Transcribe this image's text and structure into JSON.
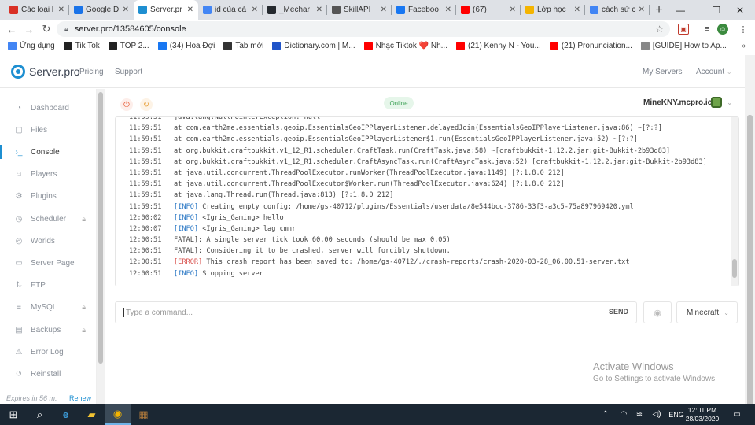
{
  "browser": {
    "tabs": [
      {
        "label": "Các loại l",
        "color": "#d93025"
      },
      {
        "label": "Google D",
        "color": "#1a73e8"
      },
      {
        "label": "Server.pr",
        "color": "#1e8fd1"
      },
      {
        "label": "id của cá",
        "color": "#4285f4"
      },
      {
        "label": "_Mechar",
        "color": "#24292e"
      },
      {
        "label": "SkillAPI",
        "color": "#555555"
      },
      {
        "label": "Faceboo",
        "color": "#1877f2"
      },
      {
        "label": "(67)",
        "color": "#ff0000"
      },
      {
        "label": "Lớp học",
        "color": "#f4b400"
      },
      {
        "label": "cách sử c",
        "color": "#4285f4"
      }
    ],
    "url": "server.pro/13584605/console",
    "bookmarks": [
      {
        "label": "Ứng dụng",
        "icon": "apps-grid-icon",
        "color": "#4285f4"
      },
      {
        "label": "Tik Tok",
        "icon": "music-note-icon",
        "color": "#222222"
      },
      {
        "label": "TOP 2...",
        "icon": "tiktok-icon",
        "color": "#222222"
      },
      {
        "label": "(34) Hoa Đợi",
        "icon": "facebook-icon",
        "color": "#1877f2"
      },
      {
        "label": "Tab mới",
        "icon": "globe-icon",
        "color": "#333333"
      },
      {
        "label": "Dictionary.com | M...",
        "icon": "dictionary-icon",
        "color": "#2054c8"
      },
      {
        "label": "Nhạc Tiktok ❤️ Nh...",
        "icon": "youtube-icon",
        "color": "#ff0000"
      },
      {
        "label": "(21) Kenny N - You...",
        "icon": "youtube-icon",
        "color": "#ff0000"
      },
      {
        "label": "(21) Pronunciation...",
        "icon": "youtube-icon",
        "color": "#ff0000"
      },
      {
        "label": "[GUIDE] How to Ap...",
        "icon": "page-icon",
        "color": "#888888"
      }
    ]
  },
  "site": {
    "logo": "Server.pro",
    "nav": {
      "pricing": "Pricing",
      "support": "Support",
      "my_servers": "My Servers",
      "account": "Account"
    },
    "sidebar": [
      {
        "label": "Dashboard",
        "icon": "◔",
        "locked": false,
        "active": false
      },
      {
        "label": "Files",
        "icon": "▢",
        "locked": false,
        "active": false
      },
      {
        "label": "Console",
        "icon": "›_",
        "locked": false,
        "active": true
      },
      {
        "label": "Players",
        "icon": "☺",
        "locked": false,
        "active": false
      },
      {
        "label": "Plugins",
        "icon": "⚙",
        "locked": false,
        "active": false
      },
      {
        "label": "Scheduler",
        "icon": "◷",
        "locked": true,
        "active": false
      },
      {
        "label": "Worlds",
        "icon": "◎",
        "locked": false,
        "active": false
      },
      {
        "label": "Server Page",
        "icon": "▭",
        "locked": false,
        "active": false
      },
      {
        "label": "FTP",
        "icon": "⇅",
        "locked": false,
        "active": false
      },
      {
        "label": "MySQL",
        "icon": "≡",
        "locked": true,
        "active": false
      },
      {
        "label": "Backups",
        "icon": "▤",
        "locked": true,
        "active": false
      },
      {
        "label": "Error Log",
        "icon": "⚠",
        "locked": false,
        "active": false
      },
      {
        "label": "Reinstall",
        "icon": "↺",
        "locked": false,
        "active": false
      }
    ],
    "expires": "Expires in 56 m.",
    "renew": "Renew",
    "status": "Online",
    "server_name": "MineKNY.mcpro.io",
    "console_lines": [
      {
        "time": "11:59:51",
        "tag": "",
        "text": "java.lang.NullPointerException: null"
      },
      {
        "time": "11:59:51",
        "tag": "",
        "text": "at com.earth2me.essentials.geoip.EssentialsGeoIPPlayerListener.delayedJoin(EssentialsGeoIPPlayerListener.java:86) ~[?:?]"
      },
      {
        "time": "11:59:51",
        "tag": "",
        "text": "at com.earth2me.essentials.geoip.EssentialsGeoIPPlayerListener$1.run(EssentialsGeoIPPlayerListener.java:52) ~[?:?]"
      },
      {
        "time": "11:59:51",
        "tag": "",
        "text": "at org.bukkit.craftbukkit.v1_12_R1.scheduler.CraftTask.run(CraftTask.java:58) ~[craftbukkit-1.12.2.jar:git-Bukkit-2b93d83]"
      },
      {
        "time": "11:59:51",
        "tag": "",
        "text": "at org.bukkit.craftbukkit.v1_12_R1.scheduler.CraftAsyncTask.run(CraftAsyncTask.java:52) [craftbukkit-1.12.2.jar:git-Bukkit-2b93d83]"
      },
      {
        "time": "11:59:51",
        "tag": "",
        "text": "at java.util.concurrent.ThreadPoolExecutor.runWorker(ThreadPoolExecutor.java:1149) [?:1.8.0_212]"
      },
      {
        "time": "11:59:51",
        "tag": "",
        "text": "at java.util.concurrent.ThreadPoolExecutor$Worker.run(ThreadPoolExecutor.java:624) [?:1.8.0_212]"
      },
      {
        "time": "11:59:51",
        "tag": "",
        "text": "at java.lang.Thread.run(Thread.java:813) [?:1.8.0_212]"
      },
      {
        "time": "11:59:51",
        "tag": "[INFO]",
        "text": "Creating empty config: /home/gs-40712/plugins/Essentials/userdata/8e544bcc-3786-33f3-a3c5-75a897969420.yml"
      },
      {
        "time": "12:00:02",
        "tag": "[INFO]",
        "text": "<Igris_Gaming> hello"
      },
      {
        "time": "12:00:07",
        "tag": "[INFO]",
        "text": "<Igris_Gaming> lag cmnr"
      },
      {
        "time": "12:00:51",
        "tag": "",
        "text": "FATAL]: A single server tick took 60.00 seconds (should be max 0.05)"
      },
      {
        "time": "12:00:51",
        "tag": "",
        "text": "FATAL]: Considering it to be crashed, server will forcibly shutdown."
      },
      {
        "time": "12:00:51",
        "tag": "[ERROR]",
        "text": "This crash report has been saved to: /home/gs-40712/./crash-reports/crash-2020-03-28_06.00.51-server.txt"
      },
      {
        "time": "12:00:51",
        "tag": "[INFO]",
        "text": "Stopping server"
      }
    ],
    "command_placeholder": "Type a command...",
    "send": "SEND",
    "game": "Minecraft",
    "watermark": {
      "line1": "Activate Windows",
      "line2": "Go to Settings to activate Windows."
    }
  },
  "taskbar": {
    "language": "ENG",
    "time": "12:01 PM",
    "date": "28/03/2020"
  }
}
